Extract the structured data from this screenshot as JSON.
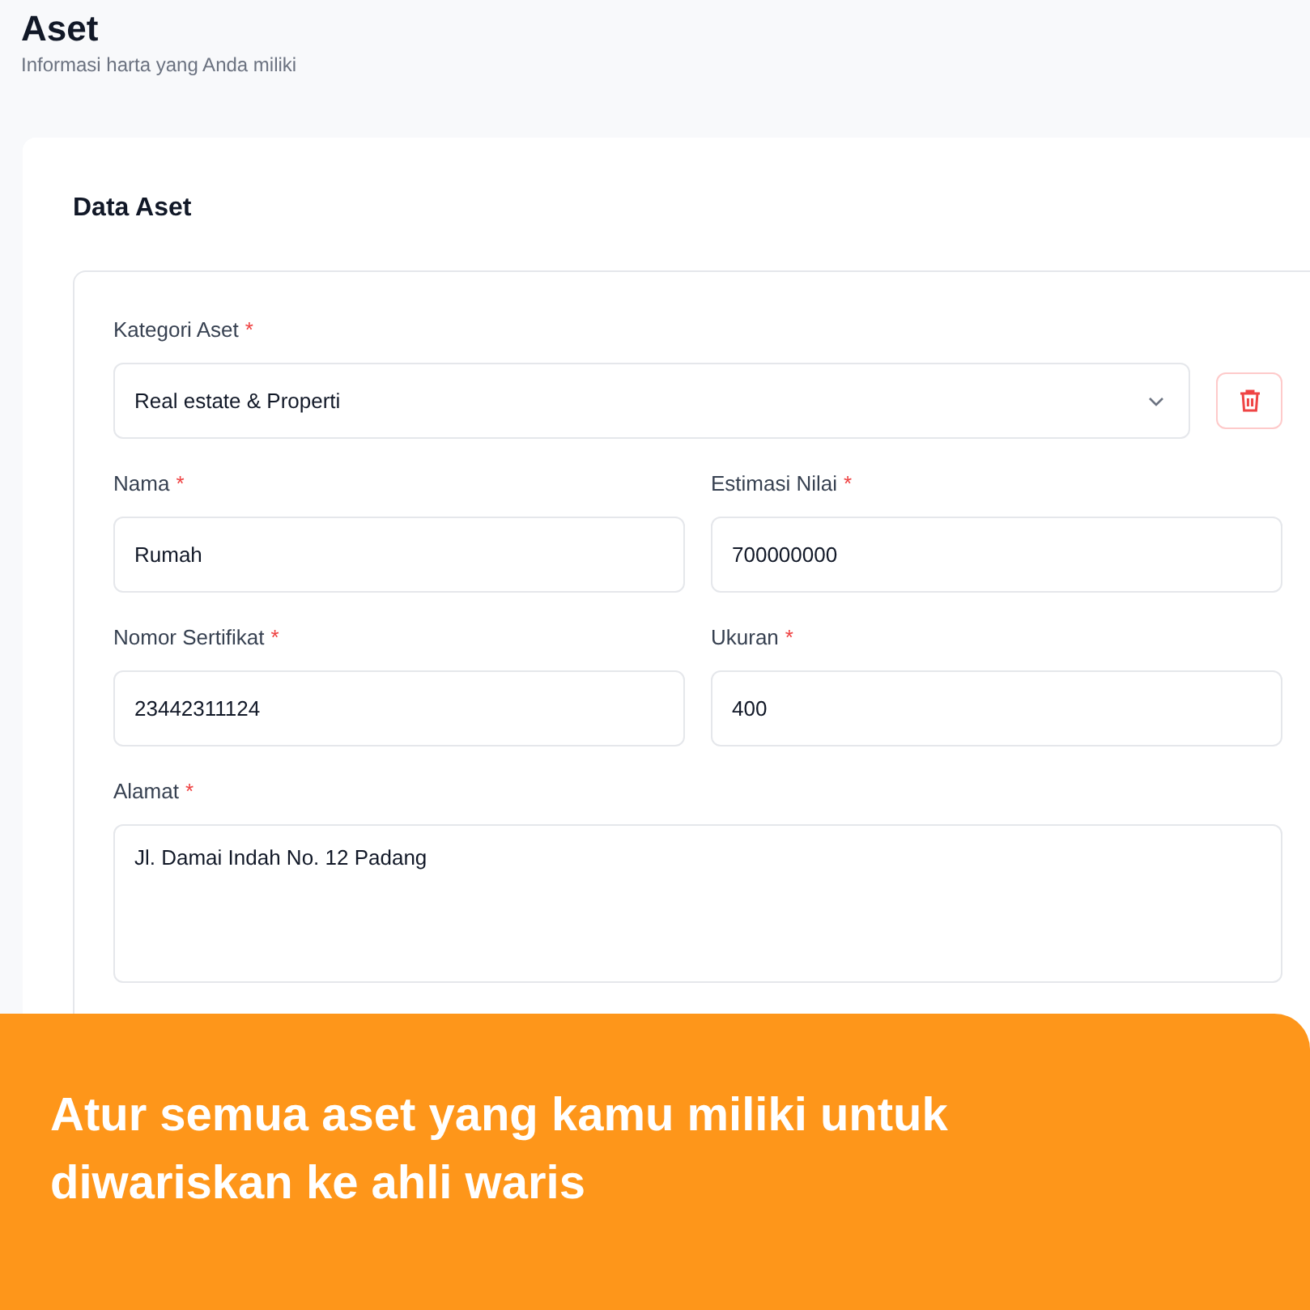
{
  "header": {
    "title": "Aset",
    "subtitle": "Informasi harta yang Anda miliki"
  },
  "card": {
    "title": "Data Aset",
    "category": {
      "label": "Kategori Aset",
      "required_mark": "*",
      "value": "Real estate & Properti"
    },
    "fields": [
      {
        "kind": "text",
        "label": "Nama",
        "required_mark": "*",
        "value": "Rumah"
      },
      {
        "kind": "text",
        "label": "Estimasi Nilai",
        "required_mark": "*",
        "value": "700000000"
      },
      {
        "kind": "text",
        "label": "Nomor Sertifikat",
        "required_mark": "*",
        "value": "23442311124"
      },
      {
        "kind": "text",
        "label": "Ukuran",
        "required_mark": "*",
        "value": "400"
      },
      {
        "kind": "textarea",
        "label": "Alamat",
        "required_mark": "*",
        "value": "Jl. Damai Indah No. 12 Padang"
      }
    ]
  },
  "banner": {
    "text": "Atur semua aset yang kamu miliki untuk diwariskan ke ahli waris"
  }
}
